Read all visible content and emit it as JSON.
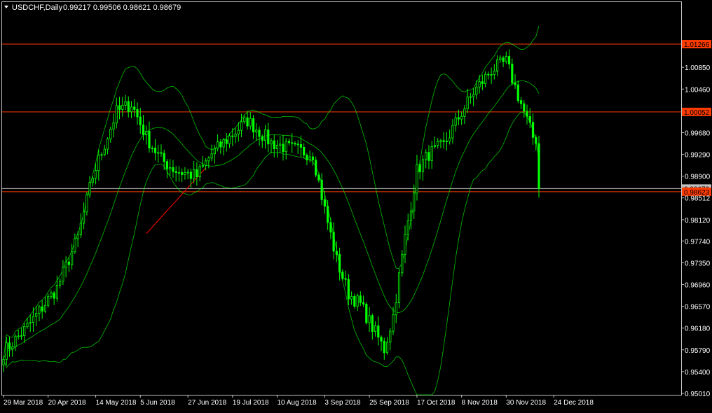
{
  "header": {
    "symbol_label": "USDCHF,Daily",
    "ohlc_label": "0.99217 0.99506 0.98621 0.98679"
  },
  "colors": {
    "background": "#000000",
    "frame": "#c0c0c0",
    "candle": "#00ff00",
    "indicator": "#00ff00",
    "level_line": "#ff3b00",
    "price_badge_bg": "#ff3b00",
    "current_line": "#c0c0c0",
    "trend_line": "#ff0000",
    "axis_text": "#ffffff"
  },
  "chart_data": {
    "type": "candlestick",
    "title": "USDCHF,Daily",
    "price_axis": {
      "ylim": [
        0.9501,
        1.0168
      ],
      "tick_labels": [
        "1.00850",
        "1.00460",
        "0.99680",
        "0.99290",
        "0.98900",
        "0.98512",
        "0.98120",
        "0.97740",
        "0.97350",
        "0.96960",
        "0.96570",
        "0.96180",
        "0.95790",
        "0.95400",
        "0.95010"
      ]
    },
    "time_axis": {
      "tick_labels": [
        "29 Mar 2018",
        "20 Apr 2018",
        "14 May 2018",
        "5 Jun 2018",
        "27 Jun 2018",
        "19 Jul 2018",
        "10 Aug 2018",
        "3 Sep 2018",
        "25 Sep 2018",
        "17 Oct 2018",
        "8 Nov 2018",
        "30 Nov 2018",
        "24 Dec 2018"
      ]
    },
    "horizontal_levels": [
      {
        "price": 1.01266,
        "label": "1.01266"
      },
      {
        "price": 1.00052,
        "label": "1.00052"
      },
      {
        "price": 0.98623,
        "label": "0.98623"
      }
    ],
    "current_price": {
      "price": 0.98679,
      "label": "0.98679"
    },
    "trend_line": {
      "from": {
        "bar": 48,
        "price": 0.9787
      },
      "to": {
        "bar": 68,
        "price": 0.9905
      }
    },
    "indicator": {
      "name": "Bollinger Bands",
      "bands": 3
    },
    "bars": 181
  }
}
